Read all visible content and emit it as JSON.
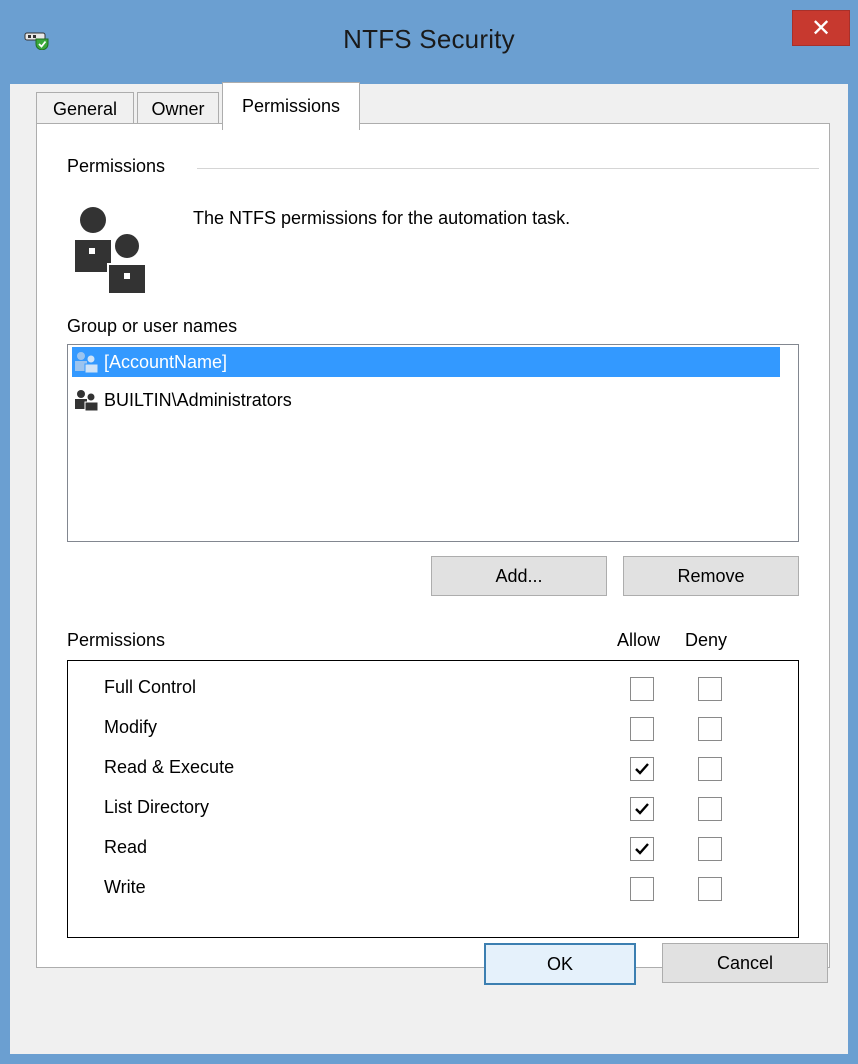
{
  "window": {
    "title": "NTFS Security",
    "close_glyph": "✕"
  },
  "tabs": [
    {
      "label": "General",
      "active": false
    },
    {
      "label": "Owner",
      "active": false
    },
    {
      "label": "Permissions",
      "active": true
    }
  ],
  "permissions_group": {
    "label": "Permissions",
    "description": "The NTFS permissions for the automation task.",
    "icon": "users-icon"
  },
  "users": {
    "label": "Group or user names",
    "items": [
      {
        "name": "[AccountName]",
        "selected": true,
        "icon": "user-group-icon"
      },
      {
        "name": "BUILTIN\\Administrators",
        "selected": false,
        "icon": "user-group-icon"
      }
    ]
  },
  "buttons": {
    "add": "Add...",
    "remove": "Remove",
    "ok": "OK",
    "cancel": "Cancel"
  },
  "permissions": {
    "label": "Permissions",
    "allow_label": "Allow",
    "deny_label": "Deny",
    "rows": [
      {
        "name": "Full Control",
        "allow": false,
        "deny": false
      },
      {
        "name": "Modify",
        "allow": false,
        "deny": false
      },
      {
        "name": "Read & Execute",
        "allow": true,
        "deny": false
      },
      {
        "name": "List Directory",
        "allow": true,
        "deny": false
      },
      {
        "name": "Read",
        "allow": true,
        "deny": false
      },
      {
        "name": "Write",
        "allow": false,
        "deny": false
      }
    ]
  },
  "colors": {
    "titlebar": "#6b9fd1",
    "close": "#c7392f",
    "selection": "#3399ff"
  }
}
